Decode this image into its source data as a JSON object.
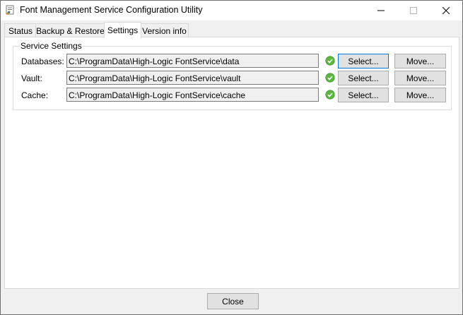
{
  "window": {
    "title": "Font Management Service Configuration Utility"
  },
  "tabs": [
    {
      "label": "Status"
    },
    {
      "label": "Backup & Restore"
    },
    {
      "label": "Settings"
    },
    {
      "label": "Version info"
    }
  ],
  "active_tab": "Settings",
  "service_settings": {
    "group_label": "Service Settings",
    "rows": [
      {
        "label": "Databases:",
        "path": "C:\\ProgramData\\High-Logic FontService\\data",
        "status": "ok",
        "select_label": "Select...",
        "move_label": "Move..."
      },
      {
        "label": "Vault:",
        "path": "C:\\ProgramData\\High-Logic FontService\\vault",
        "status": "ok",
        "select_label": "Select...",
        "move_label": "Move..."
      },
      {
        "label": "Cache:",
        "path": "C:\\ProgramData\\High-Logic FontService\\cache",
        "status": "ok",
        "select_label": "Select...",
        "move_label": "Move..."
      }
    ]
  },
  "footer": {
    "close_label": "Close"
  },
  "colors": {
    "ok_green": "#5cb83f",
    "focus_blue": "#0078d7",
    "button_face": "#e1e1e1"
  },
  "icons": {
    "app": "font-settings-icon",
    "status": "check-circle-icon"
  }
}
